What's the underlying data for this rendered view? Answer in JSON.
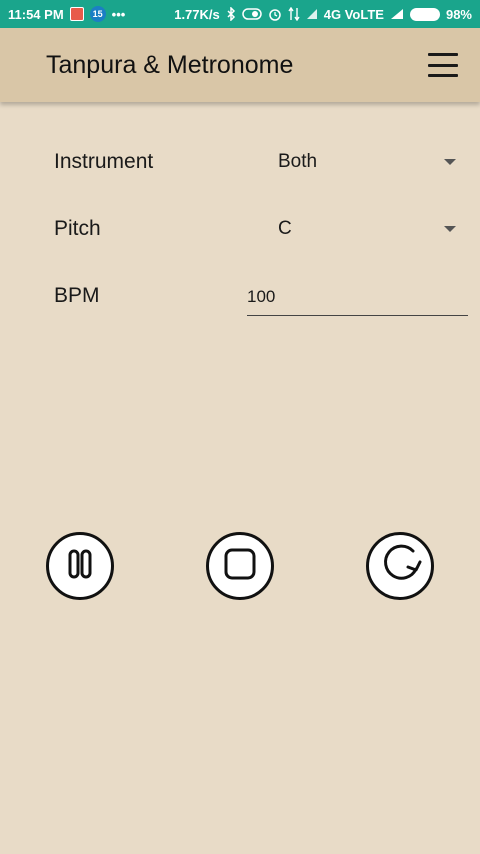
{
  "status_bar": {
    "time": "11:54 PM",
    "badge_count": "15",
    "more": "•••",
    "net_speed": "1.77K/s",
    "network": "4G VoLTE",
    "battery": "98%"
  },
  "app_bar": {
    "title": "Tanpura & Metronome",
    "menu_icon": "hamburger-menu-icon"
  },
  "form": {
    "instrument": {
      "label": "Instrument",
      "value": "Both"
    },
    "pitch": {
      "label": "Pitch",
      "value": "C"
    },
    "bpm": {
      "label": "BPM",
      "value": "100"
    }
  },
  "controls": [
    "pause-icon",
    "stop-icon",
    "repeat-icon"
  ],
  "colors": {
    "status_bar": "#1aa58c",
    "app_bar": "#d9c6a7",
    "background": "#e8dbc7"
  }
}
